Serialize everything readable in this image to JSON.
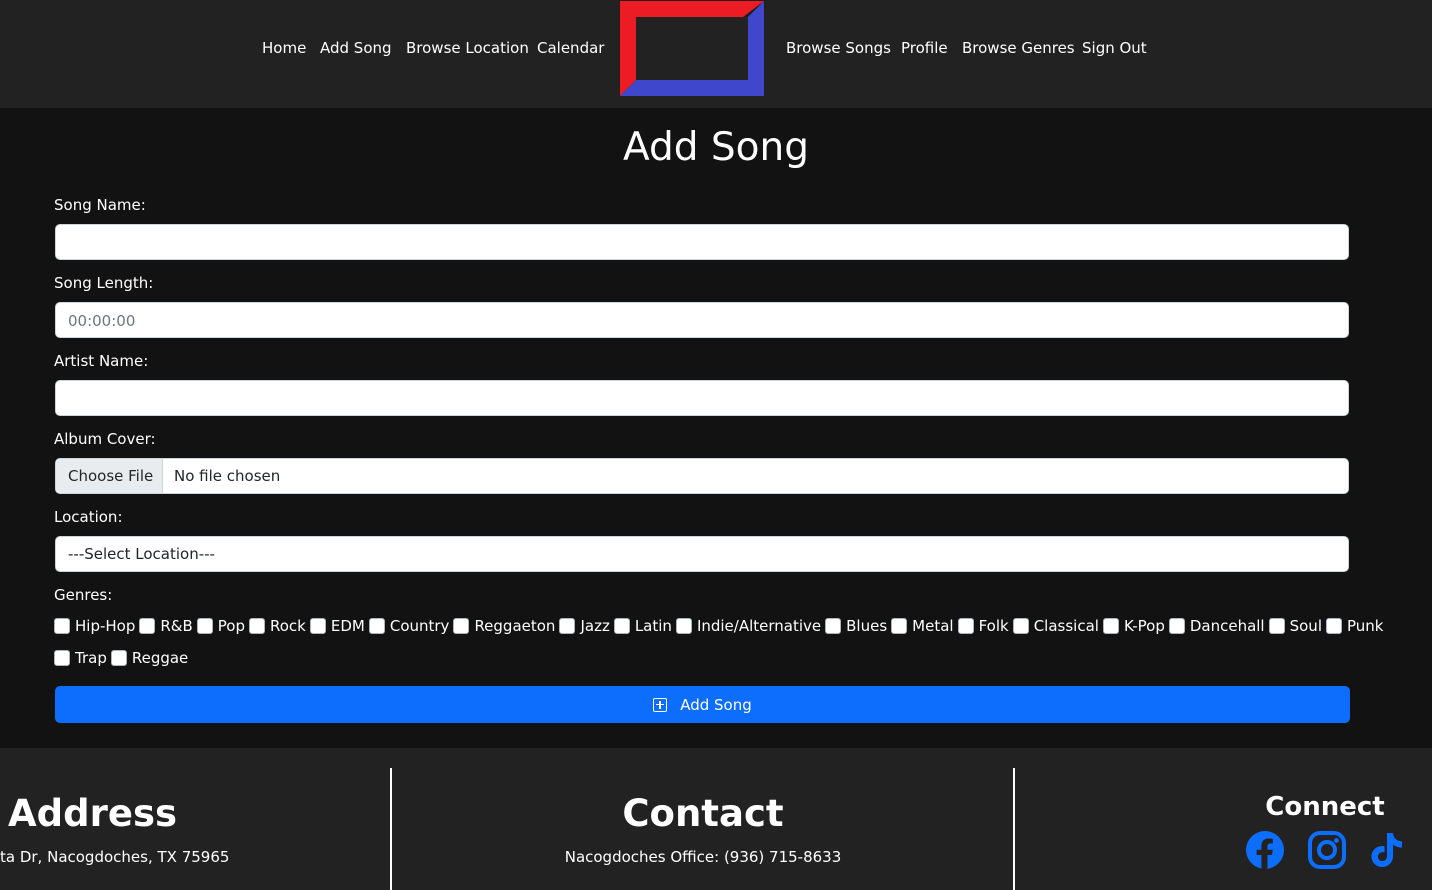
{
  "nav": {
    "left_links": [
      "Home",
      "Add Song",
      "Browse Location",
      "Calendar"
    ],
    "right_links": [
      "Browse Songs",
      "Profile",
      "Browse Genres",
      "Sign Out"
    ]
  },
  "page": {
    "title": "Add Song"
  },
  "form": {
    "song_name_label": "Song Name:",
    "song_name_value": "",
    "song_length_label": "Song Length:",
    "song_length_placeholder": "00:00:00",
    "artist_name_label": "Artist Name:",
    "artist_name_value": "",
    "album_cover_label": "Album Cover:",
    "choose_file_label": "Choose File",
    "file_status": "No file chosen",
    "location_label": "Location:",
    "location_selected": "---Select Location---",
    "genres_label": "Genres:",
    "genres": [
      "Hip-Hop",
      "R&B",
      "Pop",
      "Rock",
      "EDM",
      "Country",
      "Reggaeton",
      "Jazz",
      "Latin",
      "Indie/Alternative",
      "Blues",
      "Metal",
      "Folk",
      "Classical",
      "K-Pop",
      "Dancehall",
      "Soul",
      "Punk",
      "Trap",
      "Reggae"
    ],
    "submit_label": "Add Song",
    "submit_icon": "plus-square-icon"
  },
  "footer": {
    "address_heading": "Address",
    "address_text": "ta Dr, Nacogdoches, TX 75965",
    "contact_heading": "Contact",
    "contact_text": "Nacogdoches Office: (936) 715-8633",
    "connect_heading": "Connect",
    "social_icons": [
      "facebook-icon",
      "instagram-icon",
      "tiktok-icon"
    ]
  },
  "colors": {
    "navbar_bg": "#222222",
    "page_bg": "#121212",
    "primary": "#0d6efd",
    "logo_red": "#ed1c24",
    "logo_blue": "#3f48cc"
  }
}
